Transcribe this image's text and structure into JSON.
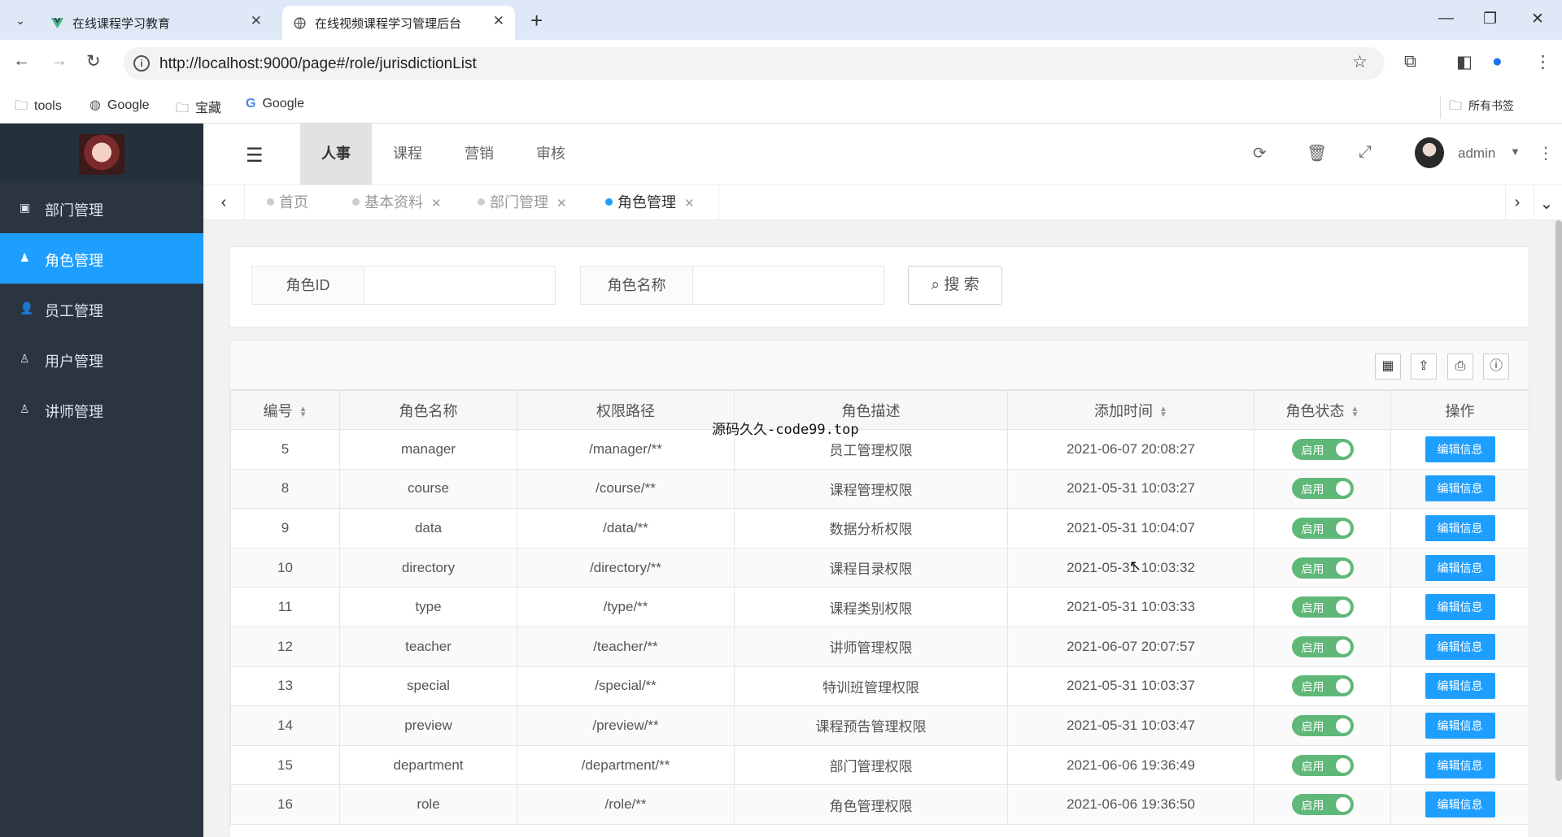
{
  "browser": {
    "tabs": [
      {
        "title": "在线课程学习教育",
        "active": false
      },
      {
        "title": "在线视频课程学习管理后台",
        "active": true
      }
    ],
    "url": "http://localhost:9000/page#/role/jurisdictionList",
    "bookmarks": [
      "tools",
      "Google",
      "宝藏",
      "Google"
    ],
    "all_bookmarks": "所有书签"
  },
  "sidebar": {
    "items": [
      {
        "label": "部门管理",
        "icon": "id-card-icon"
      },
      {
        "label": "角色管理",
        "icon": "user-role-icon",
        "active": true
      },
      {
        "label": "员工管理",
        "icon": "user-add-icon"
      },
      {
        "label": "用户管理",
        "icon": "user-icon"
      },
      {
        "label": "讲师管理",
        "icon": "user-icon"
      }
    ]
  },
  "topnav": {
    "tabs": [
      "人事",
      "课程",
      "营销",
      "审核"
    ],
    "active_tab": "人事",
    "username": "admin"
  },
  "page_tabs": [
    {
      "label": "首页",
      "closable": false
    },
    {
      "label": "基本资料",
      "closable": true
    },
    {
      "label": "部门管理",
      "closable": true
    },
    {
      "label": "角色管理",
      "closable": true,
      "active": true
    }
  ],
  "search": {
    "role_id_label": "角色ID",
    "role_id_value": "",
    "role_name_label": "角色名称",
    "role_name_value": "",
    "button_label": "搜 索"
  },
  "table": {
    "headers": [
      "编号",
      "角色名称",
      "权限路径",
      "角色描述",
      "添加时间",
      "角色状态",
      "操作"
    ],
    "status_label": "启用",
    "edit_label": "编辑信息",
    "rows": [
      {
        "id": "5",
        "name": "manager",
        "path": "/manager/**",
        "desc": "员工管理权限",
        "time": "2021-06-07 20:08:27"
      },
      {
        "id": "8",
        "name": "course",
        "path": "/course/**",
        "desc": "课程管理权限",
        "time": "2021-05-31 10:03:27"
      },
      {
        "id": "9",
        "name": "data",
        "path": "/data/**",
        "desc": "数据分析权限",
        "time": "2021-05-31 10:04:07"
      },
      {
        "id": "10",
        "name": "directory",
        "path": "/directory/**",
        "desc": "课程目录权限",
        "time": "2021-05-31 10:03:32"
      },
      {
        "id": "11",
        "name": "type",
        "path": "/type/**",
        "desc": "课程类别权限",
        "time": "2021-05-31 10:03:33"
      },
      {
        "id": "12",
        "name": "teacher",
        "path": "/teacher/**",
        "desc": "讲师管理权限",
        "time": "2021-06-07 20:07:57"
      },
      {
        "id": "13",
        "name": "special",
        "path": "/special/**",
        "desc": "特训班管理权限",
        "time": "2021-05-31 10:03:37"
      },
      {
        "id": "14",
        "name": "preview",
        "path": "/preview/**",
        "desc": "课程预告管理权限",
        "time": "2021-05-31 10:03:47"
      },
      {
        "id": "15",
        "name": "department",
        "path": "/department/**",
        "desc": "部门管理权限",
        "time": "2021-06-06 19:36:49"
      },
      {
        "id": "16",
        "name": "role",
        "path": "/role/**",
        "desc": "角色管理权限",
        "time": "2021-06-06 19:36:50"
      }
    ]
  },
  "watermark": "源码久久-code99.top",
  "colors": {
    "accent": "#1e9fff",
    "status_on": "#5fb878",
    "sidebar_bg": "#2b3542"
  }
}
